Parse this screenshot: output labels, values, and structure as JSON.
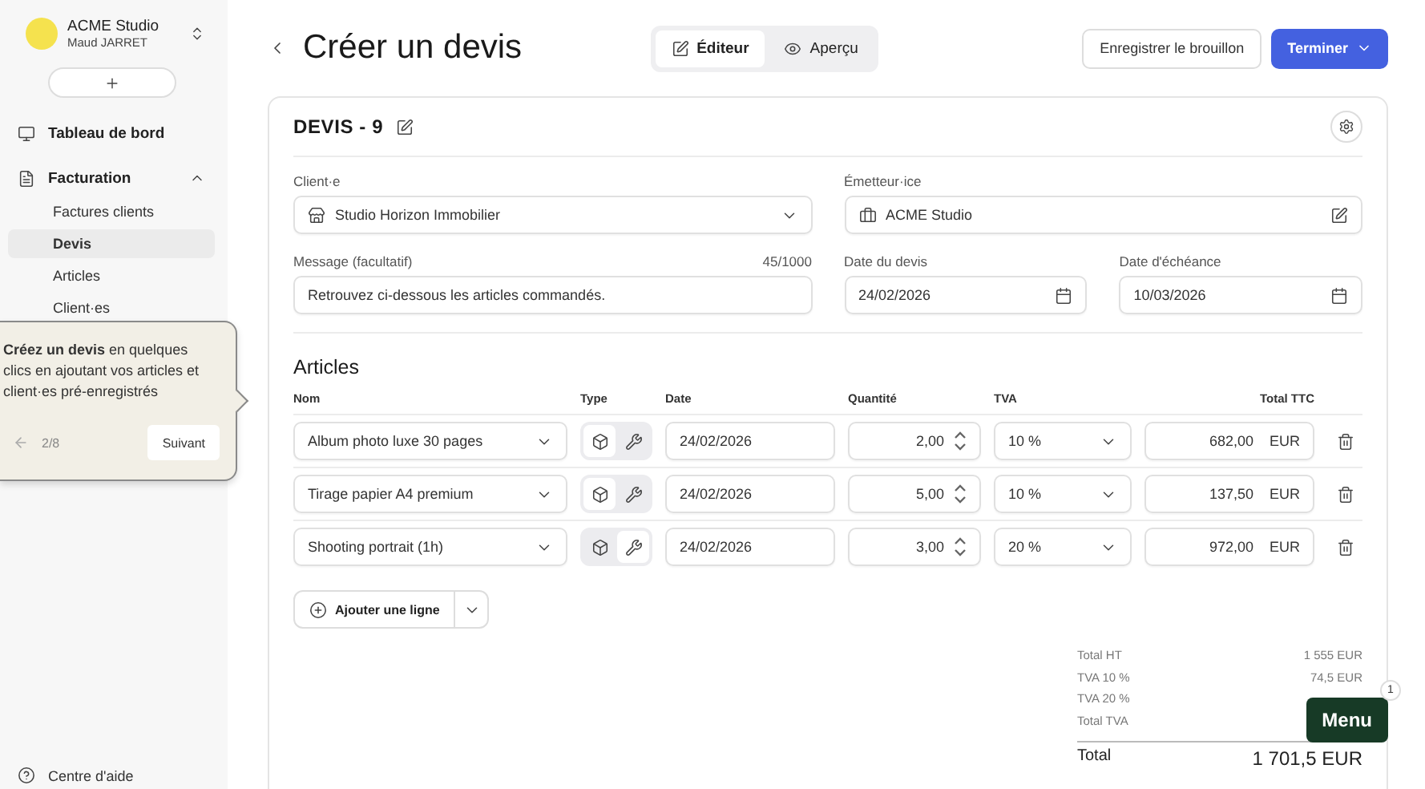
{
  "sidebar": {
    "workspace": {
      "name": "ACME Studio",
      "user": "Maud JARRET"
    },
    "dashboard": {
      "label": "Tableau de bord"
    },
    "billing": {
      "label": "Facturation",
      "expanded": true,
      "children": [
        {
          "label": "Factures clients",
          "selected": false
        },
        {
          "label": "Devis",
          "selected": true
        },
        {
          "label": "Articles",
          "selected": false
        },
        {
          "label": "Client·es",
          "selected": false
        }
      ]
    },
    "help": "Centre d'aide"
  },
  "tour_popover": {
    "text": "**Créez un devis** en quelques clics en ajoutant vos articles et client·es pré-enregistrés",
    "step": "2/8",
    "next": "Suivant"
  },
  "header": {
    "title": "Créer un devis",
    "view_tabs": [
      {
        "label": "Éditeur",
        "kind": "editor",
        "selected": true
      },
      {
        "label": "Aperçu",
        "kind": "preview",
        "selected": false
      }
    ],
    "draft_button": "Enregistrer le brouillon",
    "finish_button": "Terminer"
  },
  "quote": {
    "number": "DEVIS - 9",
    "client": {
      "label": "Client·e",
      "value": "Studio Horizon Immobilier"
    },
    "issuer": {
      "label": "Émetteur·ice",
      "value": "ACME Studio"
    },
    "message": {
      "label": "Message (facultatif)",
      "count": "45/1000",
      "value": "Retrouvez ci-dessous les articles commandés."
    },
    "quote_date": {
      "label": "Date du devis",
      "value": "24/02/2026"
    },
    "due_date": {
      "label": "Date d'échéance",
      "value": "10/03/2026"
    }
  },
  "articles": {
    "title": "Articles",
    "columns": [
      "Nom",
      "Type",
      "Date",
      "Quantité",
      "TVA",
      "Total TTC"
    ],
    "rows": [
      {
        "name": "Album photo luxe 30 pages",
        "type": [
          {
            "kind": "product",
            "selected": true
          },
          {
            "kind": "service",
            "selected": false
          }
        ],
        "date": "24/02/2026",
        "quantity": "2,00",
        "vat": "10 %",
        "total": "682,00",
        "currency": "EUR"
      },
      {
        "name": "Tirage papier A4 premium",
        "type": [
          {
            "kind": "product",
            "selected": true
          },
          {
            "kind": "service",
            "selected": false
          }
        ],
        "date": "24/02/2026",
        "quantity": "5,00",
        "vat": "10 %",
        "total": "137,50",
        "currency": "EUR"
      },
      {
        "name": "Shooting portrait (1h)",
        "type": [
          {
            "kind": "product",
            "selected": false
          },
          {
            "kind": "service",
            "selected": true
          }
        ],
        "date": "24/02/2026",
        "quantity": "3,00",
        "vat": "20 %",
        "total": "972,00",
        "currency": "EUR"
      }
    ],
    "add_button": "Ajouter une ligne"
  },
  "totals": {
    "rows": [
      {
        "label": "Total HT",
        "value": "1 555 EUR"
      },
      {
        "label": "TVA 10 %",
        "value": "74,5 EUR"
      },
      {
        "label": "TVA 20 %"
      },
      {
        "label": "Total TVA"
      }
    ],
    "grand_total": {
      "label": "Total",
      "value": "1 701,5 EUR"
    }
  },
  "menu_button": {
    "label": "Menu",
    "badge": "1"
  }
}
